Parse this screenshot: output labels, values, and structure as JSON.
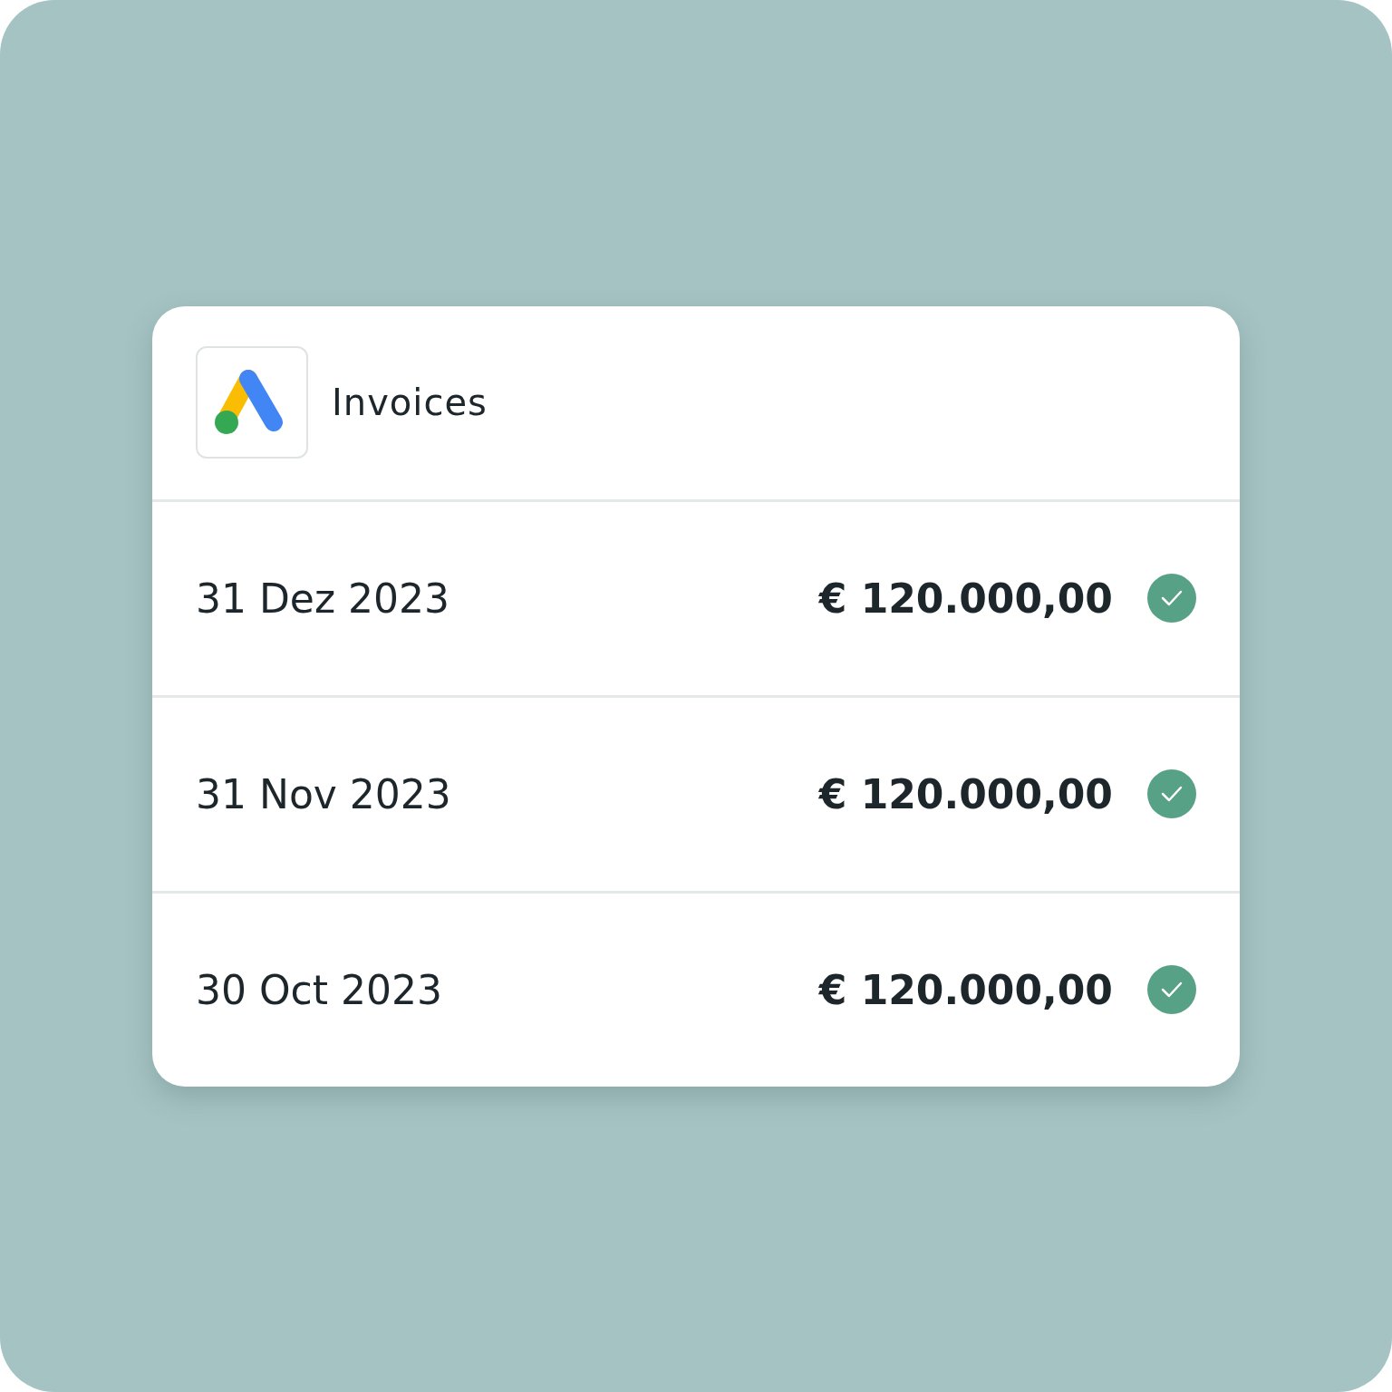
{
  "header": {
    "title": "Invoices"
  },
  "invoices": [
    {
      "date": "31 Dez 2023",
      "amount": "€ 120.000,00",
      "paid": true
    },
    {
      "date": "31 Nov 2023",
      "amount": "€ 120.000,00",
      "paid": true
    },
    {
      "date": "30 Oct 2023",
      "amount": "€ 120.000,00",
      "paid": true
    }
  ]
}
